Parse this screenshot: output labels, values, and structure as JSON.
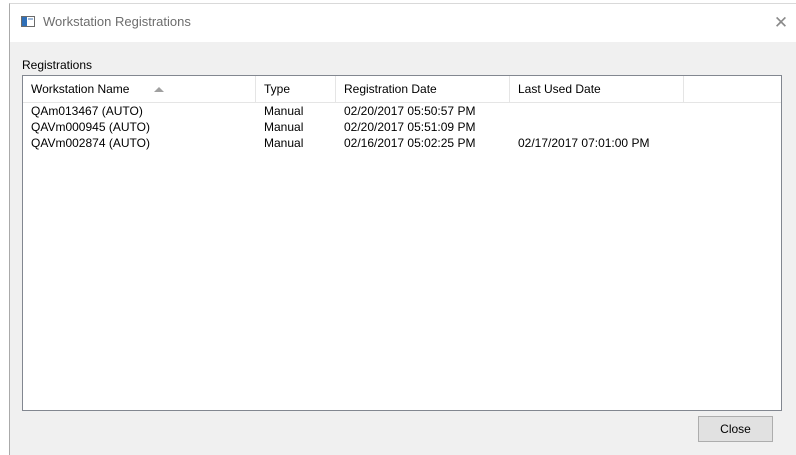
{
  "window": {
    "title": "Workstation Registrations",
    "close_glyph": "✕"
  },
  "group_label": "Registrations",
  "table": {
    "columns": [
      "Workstation Name",
      "Type",
      "Registration Date",
      "Last Used Date"
    ],
    "sorted_column": "Workstation Name",
    "sort_direction": "ascending",
    "rows": [
      [
        "QAm013467 (AUTO)",
        "Manual",
        "02/20/2017 05:50:57 PM",
        ""
      ],
      [
        "QAVm000945 (AUTO)",
        "Manual",
        "02/20/2017 05:51:09 PM",
        ""
      ],
      [
        "QAVm002874 (AUTO)",
        "Manual",
        "02/16/2017 05:02:25 PM",
        "02/17/2017 07:01:00 PM"
      ]
    ]
  },
  "buttons": {
    "close_label": "Close"
  }
}
